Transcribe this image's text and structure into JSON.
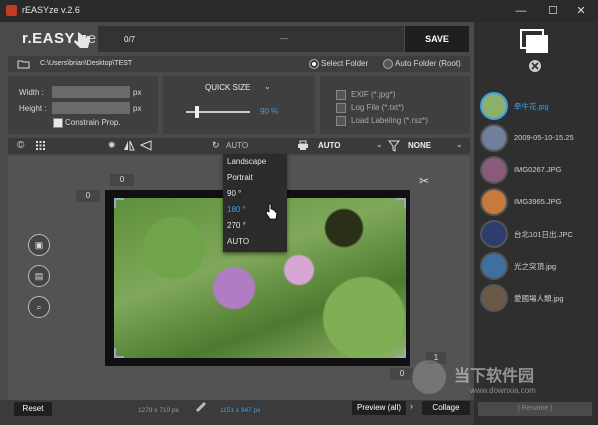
{
  "window": {
    "title": "rEASYze v.2.6",
    "minimize": "—",
    "maximize": "☐",
    "close": "✕"
  },
  "logo": {
    "main": "r.EASY",
    "suffix": ".ze"
  },
  "topbar": {
    "count": "0/7",
    "progress": "—",
    "save_label": "SAVE"
  },
  "path": {
    "value": "C:\\Users\\brian\\Desktop\\TEST",
    "select_folder": "Select Folder",
    "auto_folder": "Auto Folder (Root)"
  },
  "size": {
    "width_label": "Width :",
    "height_label": "Height :",
    "unit": "px",
    "constrain_label": "Constrain Prop."
  },
  "quick_size": {
    "label": "QUICK SIZE",
    "value": "90 %",
    "level": 0.9
  },
  "options": {
    "exif": "EXIF (*.jpg*)",
    "log": "Log File (*.txt*)",
    "load_labeling": "Load Labeling (*.rsz*)"
  },
  "toolbar": {
    "copyright": "©",
    "rotate_value": "AUTO",
    "format_value": "AUTO",
    "filter_value": "NONE"
  },
  "rotate_menu": {
    "items": [
      "Landscape",
      "Portrait",
      "90 °",
      "180 °",
      "270 °",
      "AUTO"
    ],
    "selected_index": 3
  },
  "canvas": {
    "offset_top": "0",
    "offset_left": "0",
    "offset_right": "1",
    "offset_bottom": "0"
  },
  "bottom": {
    "reset": "Reset",
    "original_size": "1279 x 710 px",
    "new_size": "1151 x 947 px",
    "preview": "Preview (all)",
    "collage": "Collage",
    "rename": "( Rename )"
  },
  "files": [
    {
      "name": "牵牛花.jpg",
      "active": true,
      "color": "#8db06a"
    },
    {
      "name": "2009-05-10-15.25",
      "active": false,
      "color": "#6f7f9c"
    },
    {
      "name": "IMG0267.JPG",
      "active": false,
      "color": "#8a5a7a"
    },
    {
      "name": "IMG3965.JPG",
      "active": false,
      "color": "#c97a3a"
    },
    {
      "name": "台北101日出.JPC",
      "active": false,
      "color": "#2c3d6e"
    },
    {
      "name": "光之突頂.jpg",
      "active": false,
      "color": "#3f6fa0"
    },
    {
      "name": "愛國場人類.jpg",
      "active": false,
      "color": "#6a5a45"
    }
  ],
  "watermark": {
    "brand": "当下软件园",
    "url": "www.downxia.com"
  },
  "colors": {
    "accent": "#3aa0e8",
    "save_bg": "#1f1f1f"
  }
}
